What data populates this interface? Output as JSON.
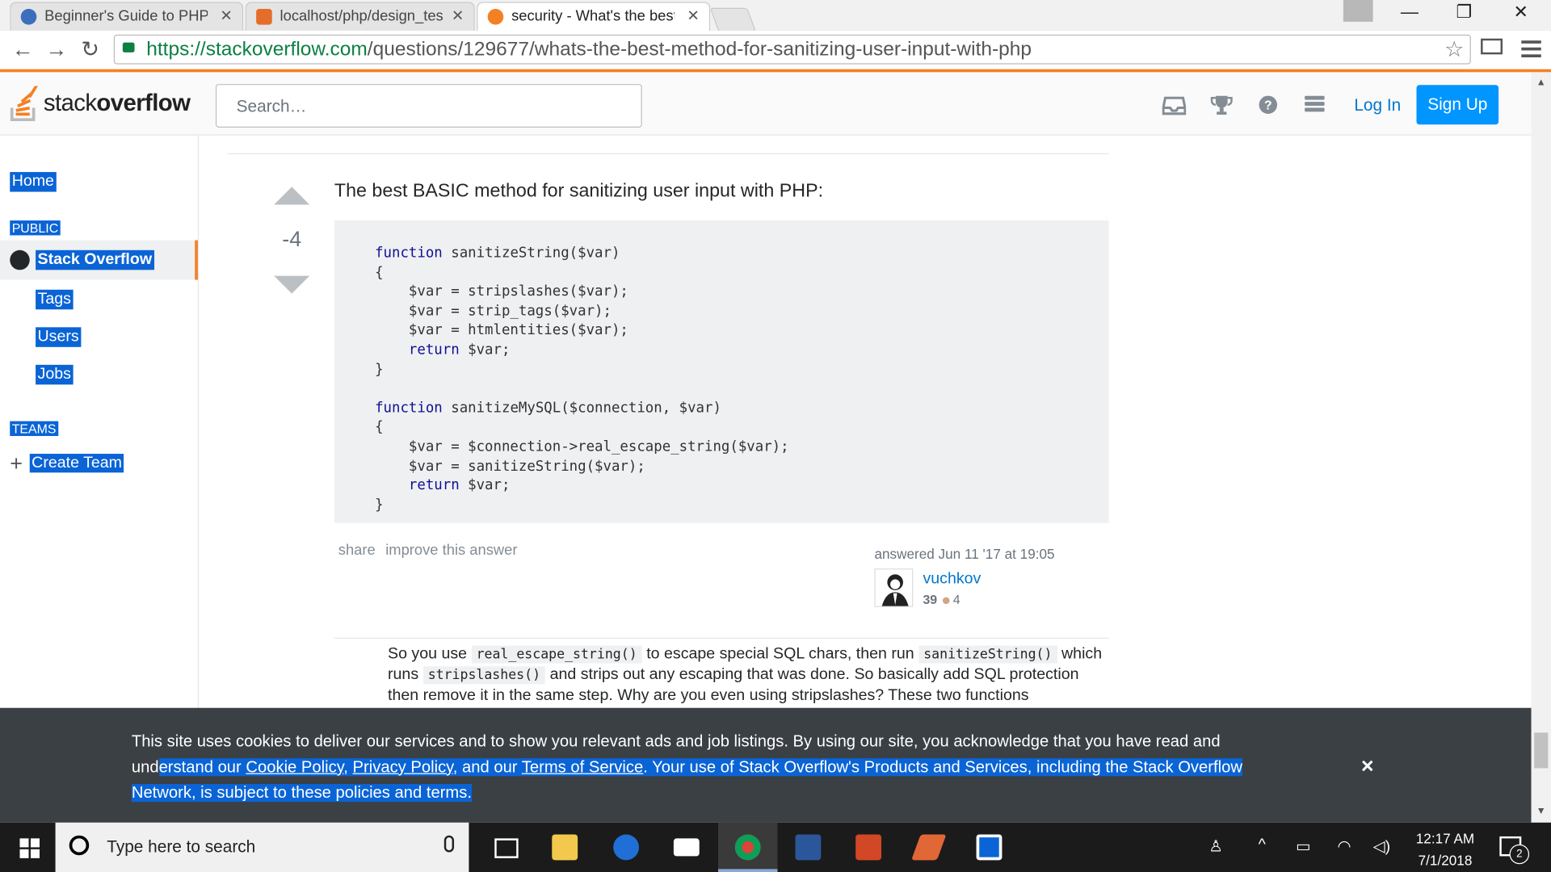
{
  "browser": {
    "tabs": [
      {
        "title": "Beginner's Guide to PHP S",
        "favicon_color": "#3b6ebd"
      },
      {
        "title": "localhost/php/design_test",
        "favicon_color": "#e56d2a"
      },
      {
        "title": "security - What's the best",
        "favicon_color": "#f48024"
      }
    ],
    "url_host": "https://stackoverflow.com",
    "url_path": "/questions/129677/whats-the-best-method-for-sanitizing-user-input-with-php"
  },
  "header": {
    "logo_stack": "stack",
    "logo_overflow": "overflow",
    "search_placeholder": "Search…",
    "login_label": "Log In",
    "signup_label": "Sign Up"
  },
  "nav": {
    "home": "Home",
    "public": "PUBLIC",
    "stackoverflow": "Stack Overflow",
    "tags": "Tags",
    "users": "Users",
    "jobs": "Jobs",
    "teams": "TEAMS",
    "create_team": "Create Team"
  },
  "answer": {
    "vote_count": "-4",
    "lead": "The best BASIC method for sanitizing user input with PHP:",
    "share": "share",
    "improve": "improve this answer",
    "answered": "answered Jun 11 '17 at 19:05",
    "user": "vuchkov",
    "reputation": "39",
    "bronze": "4"
  },
  "comment": {
    "p1": "So you use ",
    "c1": "real_escape_string()",
    "p2": " to escape special SQL chars, then run ",
    "c2": "sanitizeString()",
    "p3": " which runs ",
    "c3": "stripslashes()",
    "p4": " and strips out any escaping that was done. So basically add SQL protection then remove it in the same step. Why are you even using stripslashes? These two functions"
  },
  "cookie": {
    "t1": "This site uses cookies to deliver our services and to show you relevant ads and job listings. By using our site, you acknowledge that you have read and und",
    "t2": "erstand our ",
    "cookie_policy": "Cookie Policy",
    "comma1": ", ",
    "privacy_policy": "Privacy Policy",
    "and_our": ", and our ",
    "terms": "Terms of Service",
    "t3": ". Your use of Stack Overflow's Products and Services, including the Stack Overflow Network, is subject to these policies and terms.",
    "close": "×"
  },
  "taskbar": {
    "search_placeholder": "Type here to search",
    "time": "12:17 AM",
    "date": "7/1/2018",
    "notif_count": "2"
  }
}
